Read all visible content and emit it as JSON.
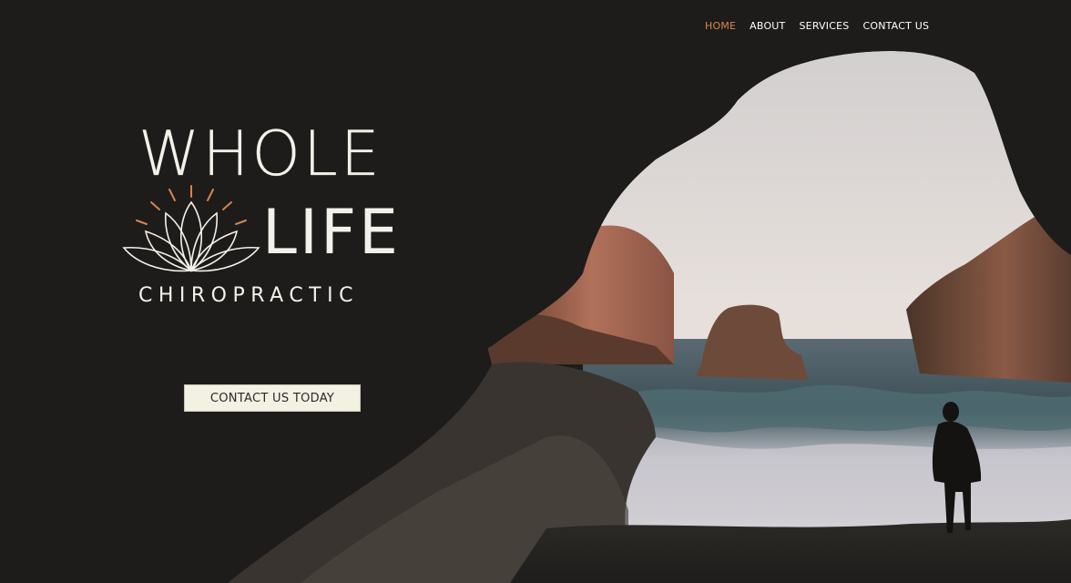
{
  "nav": {
    "items": [
      {
        "label": "HOME",
        "active": true
      },
      {
        "label": "ABOUT",
        "active": false
      },
      {
        "label": "SERVICES",
        "active": false
      },
      {
        "label": "CONTACT US",
        "active": false
      }
    ]
  },
  "logo": {
    "line1": "WHOLE",
    "line2": "LIFE",
    "line3": "CHIROPRACTIC"
  },
  "hero": {
    "cta_label": "CONTACT US TODAY"
  },
  "colors": {
    "background": "#1d1c1b",
    "accent": "#d9834c",
    "logo_text": "#f4f1ea",
    "button_bg": "#f3f1e3"
  }
}
